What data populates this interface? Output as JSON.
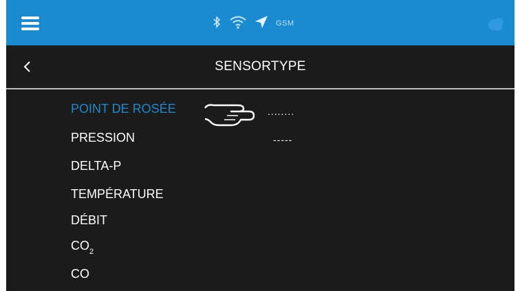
{
  "topbar": {
    "status_gsm": "GSM",
    "accent_color": "#1a8ad1",
    "icons": [
      "menu-icon",
      "bluetooth-icon",
      "wifi-icon",
      "location-arrow-icon",
      "cloud-icon"
    ]
  },
  "header": {
    "title": "SENSORTYPE",
    "back_icon": "chevron-left-icon"
  },
  "sensor_list": {
    "items": [
      {
        "label": "POINT DE ROSÉE",
        "value": "........",
        "active": true
      },
      {
        "label": "PRESSION",
        "value": "-----",
        "active": false
      },
      {
        "label": "DELTA-P",
        "value": "",
        "active": false
      },
      {
        "label": "TEMPÉRATURE",
        "value": "",
        "active": false
      },
      {
        "label": "DÉBIT",
        "value": "",
        "active": false
      },
      {
        "label": "CO",
        "subscript": "2",
        "value": "",
        "active": false
      },
      {
        "label": "CO",
        "value": "",
        "active": false
      }
    ],
    "pointer_icon": "pointing-hand-icon"
  }
}
